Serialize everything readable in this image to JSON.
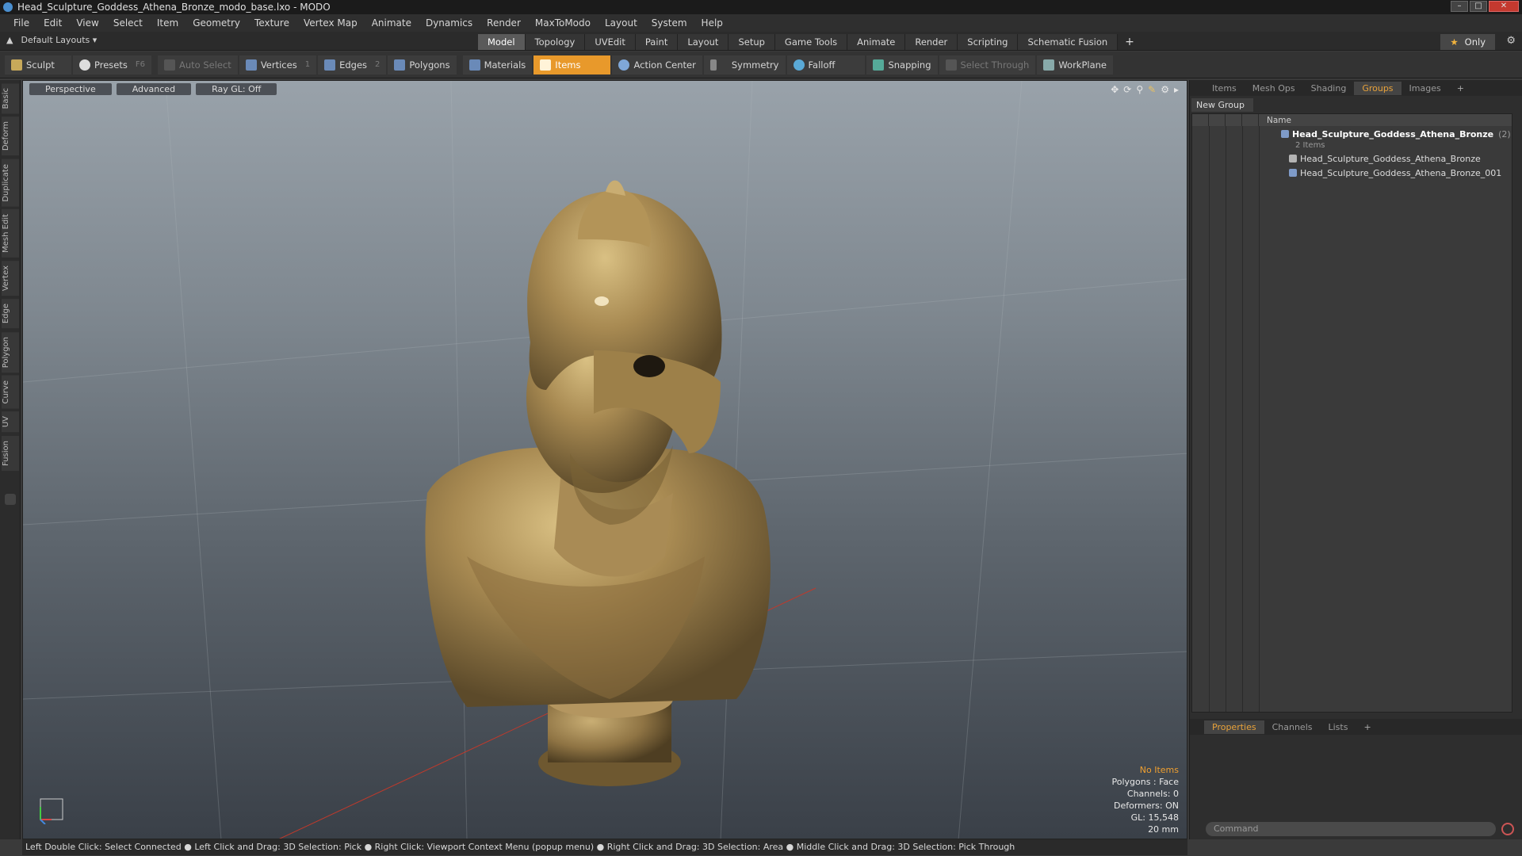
{
  "window": {
    "title": "Head_Sculpture_Goddess_Athena_Bronze_modo_base.lxo - MODO"
  },
  "menu": [
    "File",
    "Edit",
    "View",
    "Select",
    "Item",
    "Geometry",
    "Texture",
    "Vertex Map",
    "Animate",
    "Dynamics",
    "Render",
    "MaxToModo",
    "Layout",
    "System",
    "Help"
  ],
  "layoutbar": {
    "layouts": "Default Layouts",
    "tabs": [
      "Model",
      "Topology",
      "UVEdit",
      "Paint",
      "Layout",
      "Setup",
      "Game Tools",
      "Animate",
      "Render",
      "Scripting",
      "Schematic Fusion"
    ],
    "active_tab": "Model",
    "only": "Only"
  },
  "toolbar": {
    "sculpt": "Sculpt",
    "presets": "Presets",
    "presets_key": "F6",
    "auto_select": "Auto Select",
    "vertices": "Vertices",
    "vertices_count": "1",
    "edges": "Edges",
    "edges_count": "2",
    "polygons": "Polygons",
    "materials": "Materials",
    "items": "Items",
    "action_center": "Action Center",
    "symmetry": "Symmetry",
    "falloff": "Falloff",
    "snapping": "Snapping",
    "select_through": "Select Through",
    "workplane": "WorkPlane"
  },
  "left_tabs": [
    "Basic",
    "Deform",
    "Duplicate",
    "Mesh Edit",
    "Vertex",
    "Edge",
    "Polygon",
    "Curve",
    "UV",
    "Fusion"
  ],
  "viewport": {
    "view": "Perspective",
    "shading": "Advanced",
    "raygl": "Ray GL: Off",
    "info": {
      "no_items": "No Items",
      "polygons": "Polygons : Face",
      "channels": "Channels: 0",
      "deformers": "Deformers: ON",
      "gl": "GL: 15,548",
      "scale": "20 mm"
    }
  },
  "right_panel": {
    "tabs": [
      "Items",
      "Mesh Ops",
      "Shading",
      "Groups",
      "Images"
    ],
    "active_tab": "Groups",
    "new_group": "New Group",
    "column_name": "Name",
    "group": {
      "name": "Head_Sculpture_Goddess_Athena_Bronze",
      "count": "(2)",
      "sub": "2 Items",
      "children": [
        "Head_Sculpture_Goddess_Athena_Bronze",
        "Head_Sculpture_Goddess_Athena_Bronze_001"
      ]
    },
    "bottom_tabs": [
      "Properties",
      "Channels",
      "Lists"
    ],
    "bottom_active": "Properties",
    "command_placeholder": "Command"
  },
  "status": "Left Double Click: Select Connected ● Left Click and Drag: 3D Selection: Pick ● Right Click: Viewport Context Menu (popup menu) ● Right Click and Drag: 3D Selection: Area ● Middle Click and Drag: 3D Selection: Pick Through",
  "colors": {
    "accent": "#e8992b",
    "bronze": "#a88a52"
  }
}
